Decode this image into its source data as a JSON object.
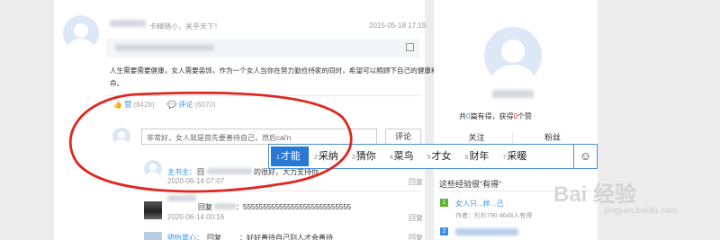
{
  "post": {
    "header_text": "卡精随小，关乎天下！",
    "timestamp": "2015-05-18 17:19",
    "body": "人生需要需要健康，女人需要装饰，作为一个女人当你在努力勤俭持家的同时，希望可以照顾下自己的健康和生",
    "body_line2": "命。",
    "like_icon": "thumbs-up-icon",
    "like_label": "赞",
    "like_count": "(8426)",
    "comment_icon": "speech-bubble-icon",
    "comment_label": "评论",
    "comment_count": "(6070)"
  },
  "comment_box": {
    "input_value": "非常好，女人就是首先要善待自己，然后cai'n",
    "submit_label": "评论"
  },
  "ime": {
    "candidates": [
      {
        "num": "1",
        "text": "才能"
      },
      {
        "num": "2",
        "text": "采纳"
      },
      {
        "num": "3",
        "text": "猜你"
      },
      {
        "num": "4",
        "text": "菜鸟"
      },
      {
        "num": "5",
        "text": "才女"
      },
      {
        "num": "6",
        "text": "财年"
      },
      {
        "num": "7",
        "text": "采暖"
      }
    ],
    "emoji": "☺"
  },
  "comments": [
    {
      "author_suffix": "主书主：",
      "text": "回",
      "text2": "的很好，大力支持你",
      "time": "2020-06-14 07:07",
      "reply": "回复"
    },
    {
      "author_suffix": "",
      "text": "回复",
      "text2": "：555555555555555555555555555",
      "time": "2020-06-14 00:16",
      "reply": "回复"
    },
    {
      "author_suffix": "明怡翠心：",
      "text": "回复",
      "text2": "：好好善待自己别人才会善待",
      "time": "",
      "reply": "回复"
    }
  ],
  "profile": {
    "stats_prefix": "共",
    "articles": "0",
    "stats_mid": "篇有得，获得",
    "likes": "0",
    "stats_suffix": "个赞",
    "follow_label": "关注",
    "fans_label": "粉丝",
    "section_title": "这些经验很“有得”",
    "items": [
      {
        "rank": "1",
        "title": "女人只...样...己",
        "meta": "作者：杉杉790   4648人有得"
      },
      {
        "rank": "2",
        "title": "",
        "meta": ""
      }
    ],
    "colors": {
      "rank1": "#5cb531",
      "rank2": "#3a8ee6"
    }
  },
  "watermark": {
    "logo": "Bai 经验",
    "url": "jingyan.baidu.com"
  },
  "annotation": {
    "color": "#e0261e",
    "shape": "hand-drawn-ellipse"
  }
}
